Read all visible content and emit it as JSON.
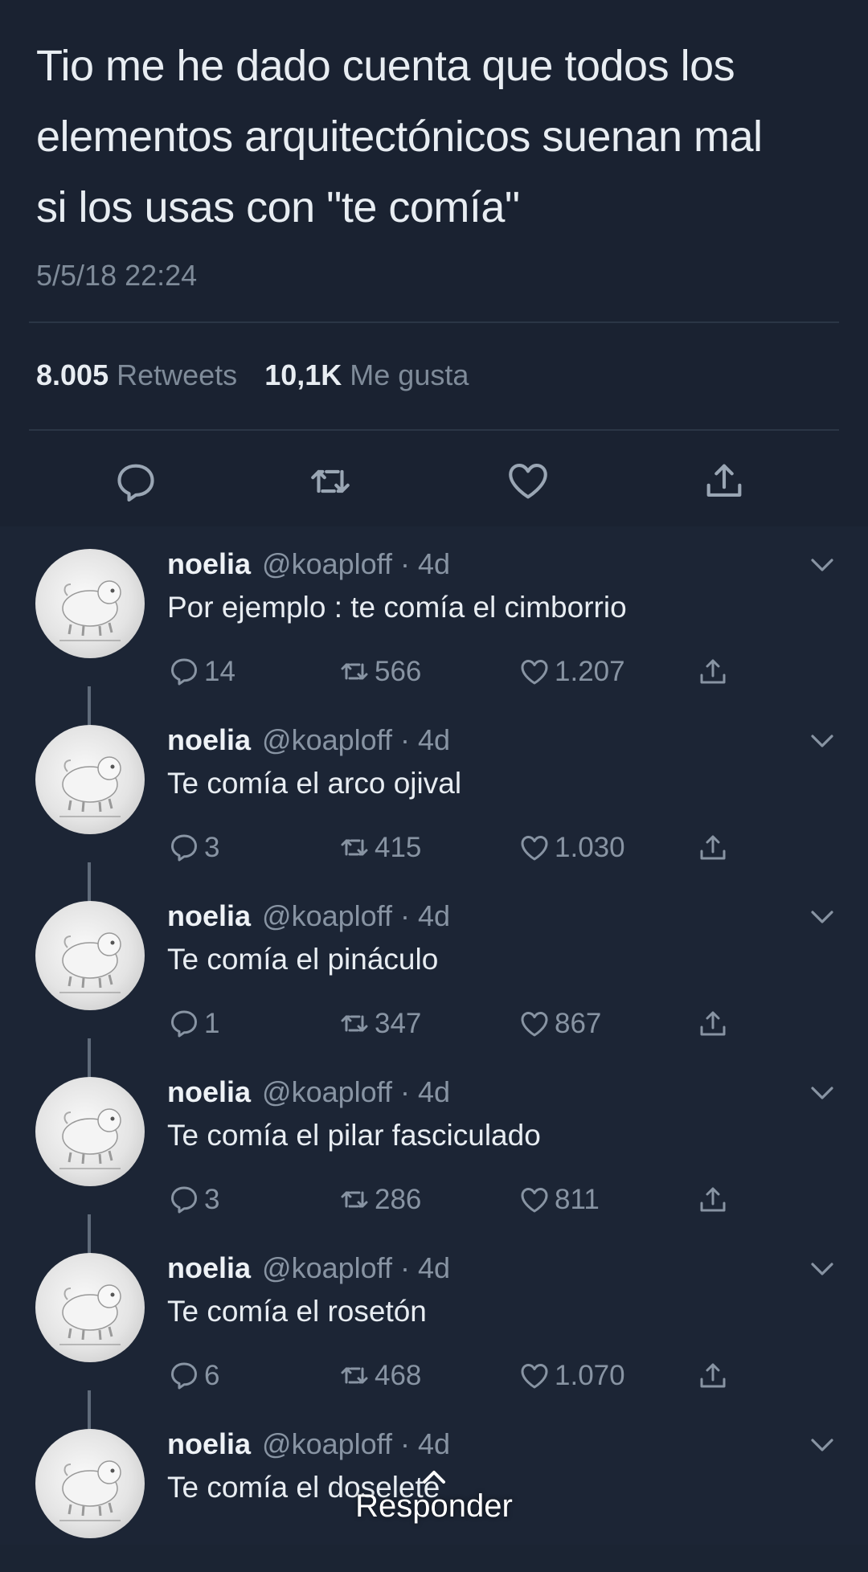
{
  "tweet": {
    "lines": [
      "Tio me he dado cuenta que todos los",
      "elementos arquitectónicos suenan mal",
      "si los usas con \"te comía\""
    ],
    "timestamp": "5/5/18 22:24",
    "retweets_count": "8.005",
    "retweets_label": "Retweets",
    "likes_count": "10,1K",
    "likes_label": "Me gusta",
    "actions": [
      "reply-icon",
      "retweet-icon",
      "like-icon",
      "share-icon"
    ]
  },
  "replies": [
    {
      "name": "noelia",
      "handle": "@koaploff · 4d",
      "text": "Por ejemplo : te comía el cimborrio",
      "replies": "14",
      "retweets": "566",
      "likes": "1.207"
    },
    {
      "name": "noelia",
      "handle": "@koaploff · 4d",
      "text": "Te comía el arco ojival",
      "replies": "3",
      "retweets": "415",
      "likes": "1.030"
    },
    {
      "name": "noelia",
      "handle": "@koaploff · 4d",
      "text": "Te comía el pináculo",
      "replies": "1",
      "retweets": "347",
      "likes": "867"
    },
    {
      "name": "noelia",
      "handle": "@koaploff · 4d",
      "text": "Te comía el pilar fasciculado",
      "replies": "3",
      "retweets": "286",
      "likes": "811"
    },
    {
      "name": "noelia",
      "handle": "@koaploff · 4d",
      "text": "Te comía el rosetón",
      "replies": "6",
      "retweets": "468",
      "likes": "1.070"
    },
    {
      "name": "noelia",
      "handle": "@koaploff · 4d",
      "text": "Te comía el doselete"
    }
  ],
  "reply_bar": {
    "label": "Responder"
  },
  "colors": {
    "background": "#1b2433",
    "text": "#e8edf2",
    "muted": "#8894a3"
  }
}
